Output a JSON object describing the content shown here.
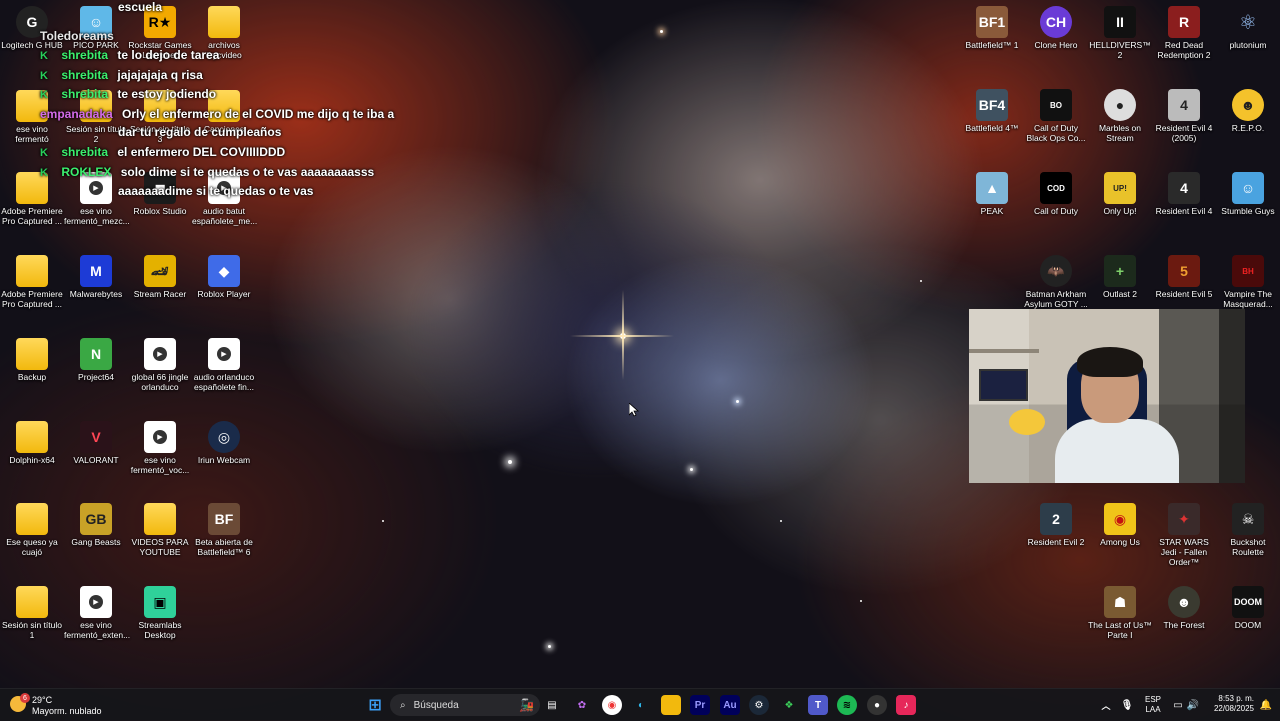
{
  "chat": [
    {
      "user": "Toledoreams",
      "message": ""
    },
    {
      "user": "shrebita",
      "message": "te lo dejo de tarea"
    },
    {
      "user": "shrebita",
      "message": "jajajajaja q risa"
    },
    {
      "user": "shrebita",
      "message": "te estoy jodiendo"
    },
    {
      "user": "empanadaka",
      "message": "Orly el enfermero de el COVID me dijo q te iba a"
    },
    {
      "user": "",
      "message": "dar tu regalo de cumpleaños"
    },
    {
      "user": "shrebita",
      "message": "el enfermero DEL COVIIIIDDD"
    },
    {
      "user": "ROKLEX",
      "message": "solo dime si te quedas o te vas aaaaaaaasss"
    },
    {
      "user": "",
      "message": "aaaaaaadime si te quedas o te vas"
    },
    {
      "user": "",
      "message": "escuela"
    }
  ],
  "desktop_icons_left": [
    {
      "label": "Logitech G HUB",
      "icon": "logitech-icon"
    },
    {
      "label": "PICO PARK",
      "icon": "pico-park-icon"
    },
    {
      "label": "Rockstar Games Launcher",
      "icon": "rockstar-icon"
    },
    {
      "label": "archivos lirycvideo",
      "icon": "folder-icon"
    },
    {
      "label": "ese vino fermentó",
      "icon": "folder-icon"
    },
    {
      "label": "Sesión sin título 2",
      "icon": "folder-icon"
    },
    {
      "label": "Sesión sin título 3",
      "icon": "folder-icon"
    },
    {
      "label": "Canciones",
      "icon": "folder-icon"
    },
    {
      "label": "Adobe Premiere Pro Captured ...",
      "icon": "folder-icon"
    },
    {
      "label": "ese vino fermentó_mezc...",
      "icon": "video-file-icon"
    },
    {
      "label": "Roblox Studio",
      "icon": "roblox-studio-icon"
    },
    {
      "label": "audio batut españolete_me...",
      "icon": "video-file-icon"
    },
    {
      "label": "Adobe Premiere Pro Captured ...",
      "icon": "folder-icon"
    },
    {
      "label": "Malwarebytes",
      "icon": "malwarebytes-icon"
    },
    {
      "label": "Stream Racer",
      "icon": "stream-racer-icon"
    },
    {
      "label": "Roblox Player",
      "icon": "roblox-icon"
    },
    {
      "label": "Backup",
      "icon": "folder-icon"
    },
    {
      "label": "Project64",
      "icon": "project64-icon"
    },
    {
      "label": "global 66 jingle orlanduco",
      "icon": "video-file-icon"
    },
    {
      "label": "audio orlanduco españolete fin...",
      "icon": "video-file-icon"
    },
    {
      "label": "Dolphin-x64",
      "icon": "folder-icon"
    },
    {
      "label": "VALORANT",
      "icon": "valorant-icon"
    },
    {
      "label": "ese vino fermentó_voc...",
      "icon": "video-file-icon"
    },
    {
      "label": "Iriun Webcam",
      "icon": "iriun-icon"
    },
    {
      "label": "Ese queso ya cuajó",
      "icon": "folder-icon"
    },
    {
      "label": "Gang Beasts",
      "icon": "gang-beasts-icon"
    },
    {
      "label": "VIDEOS PARA YOUTUBE",
      "icon": "folder-icon"
    },
    {
      "label": "Beta abierta de Battlefield™ 6",
      "icon": "battlefield6-icon"
    },
    {
      "label": "Sesión sin título 1",
      "icon": "folder-icon"
    },
    {
      "label": "ese vino fermentó_exten...",
      "icon": "video-file-icon"
    },
    {
      "label": "Streamlabs Desktop",
      "icon": "streamlabs-icon"
    }
  ],
  "desktop_icons_right": [
    {
      "label": "Battlefield™ 1",
      "icon": "battlefield1-icon"
    },
    {
      "label": "Clone Hero",
      "icon": "clone-hero-icon"
    },
    {
      "label": "HELLDIVERS™ 2",
      "icon": "helldivers-icon"
    },
    {
      "label": "Red Dead Redemption 2",
      "icon": "rdr2-icon"
    },
    {
      "label": "plutonium",
      "icon": "plutonium-icon"
    },
    {
      "label": "Battlefield 4™",
      "icon": "battlefield4-icon"
    },
    {
      "label": "Call of Duty Black Ops Co...",
      "icon": "cod-bo-icon"
    },
    {
      "label": "Marbles on Stream",
      "icon": "marbles-icon"
    },
    {
      "label": "Resident Evil 4 (2005)",
      "icon": "re4-2005-icon"
    },
    {
      "label": "R.E.P.O.",
      "icon": "repo-icon"
    },
    {
      "label": "PEAK",
      "icon": "peak-icon"
    },
    {
      "label": "Call of Duty",
      "icon": "cod-icon"
    },
    {
      "label": "Only Up!",
      "icon": "only-up-icon"
    },
    {
      "label": "Resident Evil 4",
      "icon": "re4-icon"
    },
    {
      "label": "Stumble Guys",
      "icon": "stumble-guys-icon"
    },
    {
      "label": "Batman Arkham Asylum GOTY ...",
      "icon": "batman-icon"
    },
    {
      "label": "Outlast 2",
      "icon": "outlast-icon"
    },
    {
      "label": "Resident Evil 5",
      "icon": "re5-icon"
    },
    {
      "label": "Vampire The Masquerad...",
      "icon": "vampire-icon"
    },
    {
      "label": "Resident Evil 2",
      "icon": "re2-icon"
    },
    {
      "label": "Among Us",
      "icon": "among-us-icon"
    },
    {
      "label": "STAR WARS Jedi - Fallen Order™",
      "icon": "star-wars-icon"
    },
    {
      "label": "Buckshot Roulette",
      "icon": "buckshot-icon"
    },
    {
      "label": "The Last of Us™ Parte I",
      "icon": "tlou-icon"
    },
    {
      "label": "The Forest",
      "icon": "the-forest-icon"
    },
    {
      "label": "DOOM",
      "icon": "doom-icon"
    }
  ],
  "taskbar": {
    "weather_temp": "29°C",
    "weather_desc": "Mayorm. nublado",
    "weather_badge": "6",
    "search_placeholder": "Búsqueda",
    "lang_top": "ESP",
    "lang_bottom": "LAA",
    "time": "8:53 p. m.",
    "date": "22/08/2025"
  },
  "colors": {
    "taskbar_bg": "#16161a",
    "chat_user": "#3cf06e",
    "folder": "#f2b90d"
  }
}
